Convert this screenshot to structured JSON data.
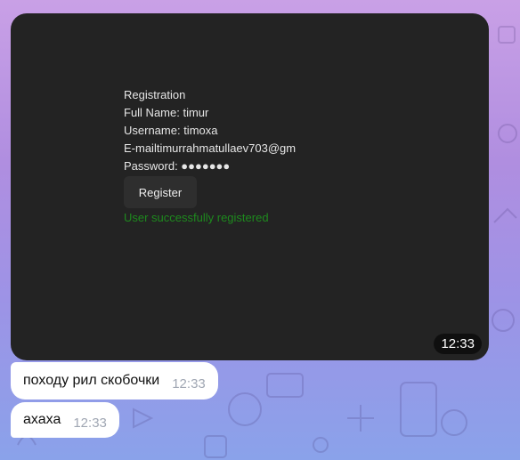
{
  "photo": {
    "form_lines": [
      "Registration",
      "Full Name: timur",
      "Username: timoxa",
      "E-mailtimurrahmatullaev703@gm",
      "Password: ●●●●●●●"
    ],
    "register_label": "Register",
    "success_text": "User successfully registered",
    "time": "12:33"
  },
  "messages": [
    {
      "text": "походу рил скобочки",
      "time": "12:33"
    },
    {
      "text": "ахаха",
      "time": "12:33"
    }
  ],
  "colors": {
    "photo_bg": "#232323",
    "success": "#1e8a1e",
    "bubble_bg": "#ffffff",
    "time_in_bubble": "#a0a7b3"
  }
}
